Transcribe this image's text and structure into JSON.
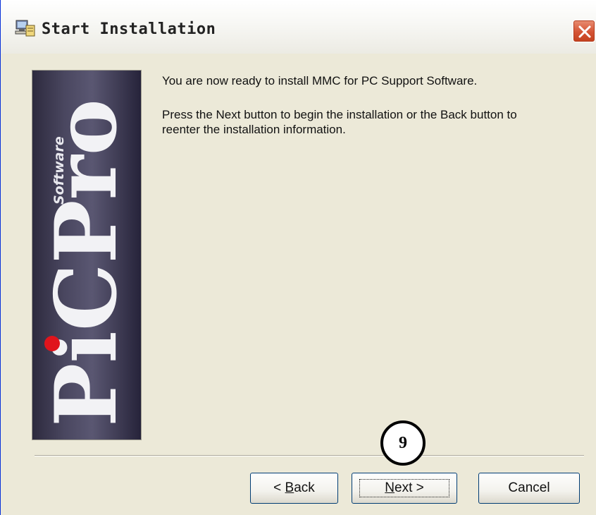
{
  "window": {
    "title": "Start Installation",
    "icon": "installer-computer-icon",
    "close_icon": "close-icon"
  },
  "banner": {
    "logo_text": "PiCPro",
    "logo_subtitle": "Software",
    "accent_color": "#e0141c"
  },
  "content": {
    "message_1": "You are now ready to install MMC for PC Support Software.",
    "message_2": "Press the Next button to begin the installation or the Back button to reenter the installation information."
  },
  "buttons": {
    "back": {
      "prefix": "< ",
      "mnemonic": "B",
      "rest": "ack"
    },
    "next": {
      "mnemonic": "N",
      "rest": "ext >"
    },
    "cancel": "Cancel"
  },
  "callout": {
    "number": "9"
  }
}
